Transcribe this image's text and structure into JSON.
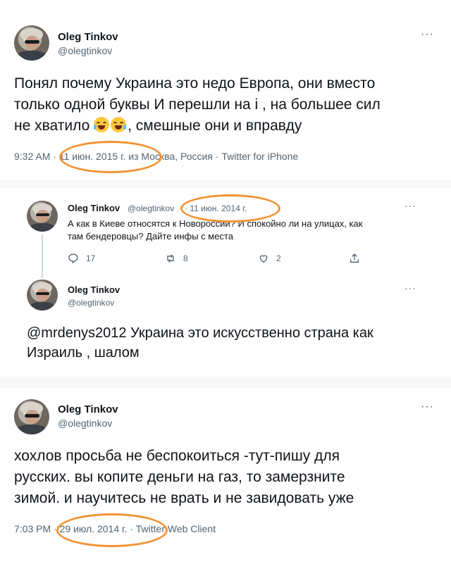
{
  "tweet1": {
    "name": "Oleg Tinkov",
    "handle": "@olegtinkov",
    "more": "···",
    "text_lines": [
      "Понял почему Украина это недо Европа, они вместо",
      "только одной буквы И перешли на і , на большее сил",
      "не хватило",
      ", смешные они и вправду"
    ],
    "emoji": [
      "face-with-tears-of-joy-icon",
      "face-with-tears-of-joy-icon"
    ],
    "meta": "9:32 AM · 11 июн. 2015 г. из Москва, Россия · Twitter for iPhone"
  },
  "tweet2a": {
    "name": "Oleg Tinkov",
    "handle": "@olegtinkov",
    "date": "· 11 июн. 2014 г.",
    "more": "···",
    "text_lines": [
      "А как в Киеве относятся к Новороссии? И спокойно ли на улицах, как",
      "там бендеровцы? Дайте инфы с места"
    ],
    "actions": {
      "reply_count": "17",
      "retweet_count": "8",
      "like_count": "2"
    }
  },
  "tweet2b": {
    "name": "Oleg Tinkov",
    "handle": "@olegtinkov",
    "more": "···",
    "text_lines": [
      "@mrdenys2012 Украина это искусственно страна как",
      "Израиль , шалом"
    ]
  },
  "tweet3": {
    "name": "Oleg Tinkov",
    "handle": "@olegtinkov",
    "more": "···",
    "text_lines": [
      "хохлов просьба не беспокоиться -тут-пишу для",
      "русских. вы копите деньги на газ, то замерзните",
      "зимой. и научитесь не врать и не завидовать уже"
    ],
    "meta": "7:03 PM · 29 июл. 2014 г. · Twitter Web Client"
  },
  "colors": {
    "text": "#0f1419",
    "secondary": "#536471",
    "highlight": "#f39233",
    "background_gap": "#f7f9f9"
  }
}
